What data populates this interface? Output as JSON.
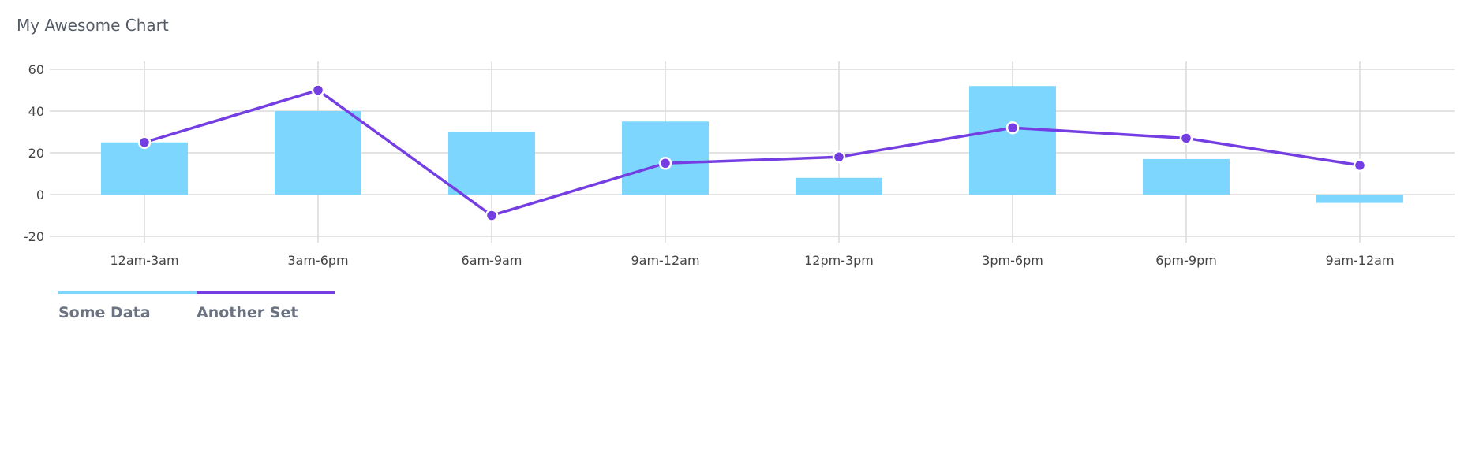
{
  "chart_data": {
    "type": "bar",
    "title": "My Awesome Chart",
    "categories": [
      "12am-3am",
      "3am-6pm",
      "6am-9am",
      "9am-12am",
      "12pm-3pm",
      "3pm-6pm",
      "6pm-9pm",
      "9am-12am"
    ],
    "ylim": [
      -20,
      60
    ],
    "yticks": [
      -20,
      0,
      20,
      40,
      60
    ],
    "grid": true,
    "legend_position": "bottom-left",
    "series": [
      {
        "name": "Some Data",
        "type": "bar",
        "color": "#7cd6fd",
        "values": [
          25,
          40,
          30,
          35,
          8,
          52,
          17,
          -4
        ]
      },
      {
        "name": "Another Set",
        "type": "line",
        "color": "#743ee2",
        "values": [
          25,
          50,
          -10,
          15,
          18,
          32,
          27,
          14
        ]
      }
    ]
  }
}
